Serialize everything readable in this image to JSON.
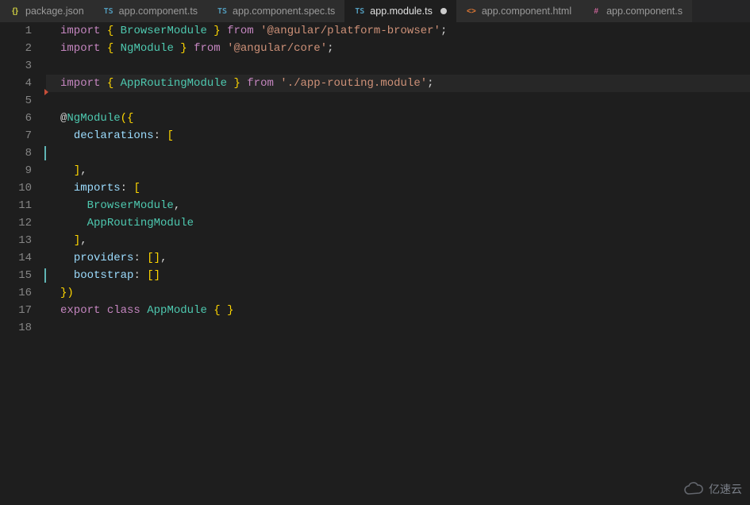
{
  "tabs": [
    {
      "icon": "json",
      "label": "package.json",
      "active": false,
      "dirty": false
    },
    {
      "icon": "ts",
      "label": "app.component.ts",
      "active": false,
      "dirty": false
    },
    {
      "icon": "ts",
      "label": "app.component.spec.ts",
      "active": false,
      "dirty": false
    },
    {
      "icon": "ts",
      "label": "app.module.ts",
      "active": true,
      "dirty": true
    },
    {
      "icon": "html",
      "label": "app.component.html",
      "active": false,
      "dirty": false
    },
    {
      "icon": "scss",
      "label": "app.component.s",
      "active": false,
      "dirty": false
    }
  ],
  "iconGlyph": {
    "json": "{}",
    "ts": "TS",
    "html": "<>",
    "scss": "#"
  },
  "code": {
    "lines": [
      [
        {
          "c": "tk-kw",
          "t": "import"
        },
        {
          "c": "tk-pn",
          "t": " "
        },
        {
          "c": "tk-br",
          "t": "{"
        },
        {
          "c": "tk-pn",
          "t": " "
        },
        {
          "c": "tk-ty",
          "t": "BrowserModule"
        },
        {
          "c": "tk-pn",
          "t": " "
        },
        {
          "c": "tk-br",
          "t": "}"
        },
        {
          "c": "tk-pn",
          "t": " "
        },
        {
          "c": "tk-kw",
          "t": "from"
        },
        {
          "c": "tk-pn",
          "t": " "
        },
        {
          "c": "tk-str",
          "t": "'@angular/platform-browser'"
        },
        {
          "c": "tk-pn",
          "t": ";"
        }
      ],
      [
        {
          "c": "tk-kw",
          "t": "import"
        },
        {
          "c": "tk-pn",
          "t": " "
        },
        {
          "c": "tk-br",
          "t": "{"
        },
        {
          "c": "tk-pn",
          "t": " "
        },
        {
          "c": "tk-ty",
          "t": "NgModule"
        },
        {
          "c": "tk-pn",
          "t": " "
        },
        {
          "c": "tk-br",
          "t": "}"
        },
        {
          "c": "tk-pn",
          "t": " "
        },
        {
          "c": "tk-kw",
          "t": "from"
        },
        {
          "c": "tk-pn",
          "t": " "
        },
        {
          "c": "tk-str",
          "t": "'@angular/core'"
        },
        {
          "c": "tk-pn",
          "t": ";"
        }
      ],
      [],
      [
        {
          "c": "tk-kw",
          "t": "import"
        },
        {
          "c": "tk-pn",
          "t": " "
        },
        {
          "c": "tk-br",
          "t": "{"
        },
        {
          "c": "tk-pn",
          "t": " "
        },
        {
          "c": "tk-ty",
          "t": "AppRoutingModule"
        },
        {
          "c": "tk-pn",
          "t": " "
        },
        {
          "c": "tk-br",
          "t": "}"
        },
        {
          "c": "tk-pn",
          "t": " "
        },
        {
          "c": "tk-kw",
          "t": "from"
        },
        {
          "c": "tk-pn",
          "t": " "
        },
        {
          "c": "tk-str",
          "t": "'./app-routing.module'"
        },
        {
          "c": "tk-pn",
          "t": ";"
        }
      ],
      [],
      [
        {
          "c": "tk-at",
          "t": "@"
        },
        {
          "c": "tk-ty",
          "t": "NgModule"
        },
        {
          "c": "tk-br",
          "t": "("
        },
        {
          "c": "tk-br",
          "t": "{"
        }
      ],
      [
        {
          "c": "tk-ws",
          "t": "  "
        },
        {
          "c": "tk-prop",
          "t": "declarations"
        },
        {
          "c": "tk-pn",
          "t": ": "
        },
        {
          "c": "tk-br",
          "t": "["
        }
      ],
      [
        {
          "c": "tk-ws",
          "t": "    "
        }
      ],
      [
        {
          "c": "tk-ws",
          "t": "  "
        },
        {
          "c": "tk-br",
          "t": "]"
        },
        {
          "c": "tk-pn",
          "t": ","
        }
      ],
      [
        {
          "c": "tk-ws",
          "t": "  "
        },
        {
          "c": "tk-prop",
          "t": "imports"
        },
        {
          "c": "tk-pn",
          "t": ": "
        },
        {
          "c": "tk-br",
          "t": "["
        }
      ],
      [
        {
          "c": "tk-ws",
          "t": "    "
        },
        {
          "c": "tk-ty",
          "t": "BrowserModule"
        },
        {
          "c": "tk-pn",
          "t": ","
        }
      ],
      [
        {
          "c": "tk-ws",
          "t": "    "
        },
        {
          "c": "tk-ty",
          "t": "AppRoutingModule"
        }
      ],
      [
        {
          "c": "tk-ws",
          "t": "  "
        },
        {
          "c": "tk-br",
          "t": "]"
        },
        {
          "c": "tk-pn",
          "t": ","
        }
      ],
      [
        {
          "c": "tk-ws",
          "t": "  "
        },
        {
          "c": "tk-prop",
          "t": "providers"
        },
        {
          "c": "tk-pn",
          "t": ": "
        },
        {
          "c": "tk-br",
          "t": "["
        },
        {
          "c": "tk-br",
          "t": "]"
        },
        {
          "c": "tk-pn",
          "t": ","
        }
      ],
      [
        {
          "c": "tk-ws",
          "t": "  "
        },
        {
          "c": "tk-prop",
          "t": "bootstrap"
        },
        {
          "c": "tk-pn",
          "t": ": "
        },
        {
          "c": "tk-br",
          "t": "["
        },
        {
          "c": "tk-br",
          "t": "]"
        }
      ],
      [
        {
          "c": "tk-br",
          "t": "}"
        },
        {
          "c": "tk-br",
          "t": ")"
        }
      ],
      [
        {
          "c": "tk-kw",
          "t": "export"
        },
        {
          "c": "tk-pn",
          "t": " "
        },
        {
          "c": "tk-kw",
          "t": "class"
        },
        {
          "c": "tk-pn",
          "t": " "
        },
        {
          "c": "tk-ty",
          "t": "AppModule"
        },
        {
          "c": "tk-pn",
          "t": " "
        },
        {
          "c": "tk-br",
          "t": "{"
        },
        {
          "c": "tk-pn",
          "t": " "
        },
        {
          "c": "tk-br",
          "t": "}"
        }
      ],
      []
    ],
    "highlightLine": 4,
    "cursorLines": [
      8,
      15
    ],
    "gitMarkAfterLine": 4
  },
  "watermark": {
    "text": "亿速云"
  }
}
